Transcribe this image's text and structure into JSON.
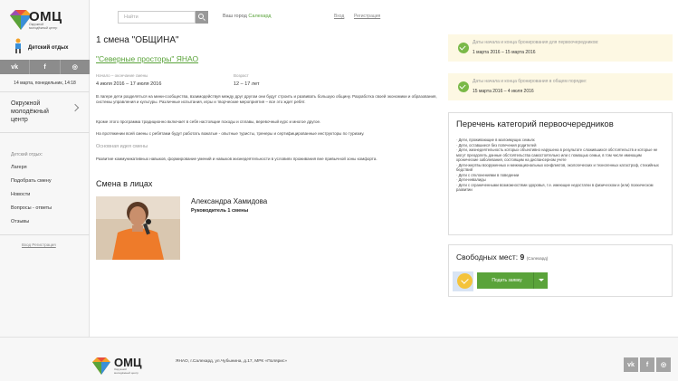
{
  "brand": {
    "name": "ОМЦ",
    "subtitle": "Окружной молодёжный центр",
    "section": "Детский отдых"
  },
  "social": {
    "vk": "vk",
    "fb": "f",
    "ig": "◎"
  },
  "date": "14 марта, понедельник, 14:18",
  "sidebar": {
    "okr": "Окружной молодёжный центр",
    "label": "Детский отдых:",
    "items": [
      "Лагеря",
      "Подобрать смену",
      "Новости",
      "Вопросы - ответы",
      "Отзывы"
    ],
    "login": "Вход Регистрация"
  },
  "search": {
    "placeholder": "Найти"
  },
  "city": {
    "label": "Ваш город",
    "name": "Салехард"
  },
  "auth": {
    "login": "Вход",
    "register": "Регистрация"
  },
  "main": {
    "title": "1 смена \"ОБЩИНА\"",
    "subtitle": "\"Северные просторы\" ЯНАО",
    "period_label": "Начало – окончание смены",
    "period_value": "4 июля 2016 – 17 июля 2016",
    "age_label": "Возраст",
    "age_value": "12 – 17 лет",
    "para1": "В лагере дети разделяться на мини-сообщества, взаимодействуя между друг другом они будут строить и развивать большую общину. Разработка своей экономики и образования, системы управления и культуры. Различные испытания, игры и творческие мероприятия – все это ждет ребят.",
    "para2": "Кроме этого программа традиционно включает в себя настоящие походы и сплавы, веревочный курс и многое другое.",
    "para3": "На протяжении всей смены с ребятами будут работать вожатые - опытные туристы, тренеры и сертифицированные инструкторы по туризму.",
    "idea_label": "Основная идея смены",
    "idea_text": "Развитие коммуникативных навыков, формирование умений и навыков жизнедеятельности в условиях проживания вне привычной зоны комфорта.",
    "faces_title": "Смена в лицах",
    "person_name": "Александра Хамидова",
    "person_role": "Руководитель 1 смены"
  },
  "notices": [
    {
      "label": "Даты начала и конца бронирования для первоочередников:",
      "value": "1 марта 2016 – 15 марта 2016"
    },
    {
      "label": "Даты начала и конца бронирования в общем порядке:",
      "value": "15 марта 2016 – 4 июля 2016"
    }
  ],
  "categories": {
    "title": "Перечень категорий первоочередников",
    "items": [
      "Дети, проживающие в малоимущих семьях",
      "Дети, оставшиеся без попечения родителей",
      "Дети, жизнедеятельность которых объективно нарушена в результате сложившихся обстоятельств и которые не могут преодолеть данные обстоятельства самостоятельно или с помощью семьи, в том числе имеющим хронические заболевания, состоящим на диспансерном учете",
      "Дети-жертвы вооруженных и межнациональных конфликтов, экологических и техногенных катастроф, стихийных бедствий",
      "Дети с отклонениями в поведении",
      "Дети-инвалиды",
      "Дети с ограниченными возможностями здоровья, т.е. имеющие недостатки в физическом и (или) психическом развитии"
    ]
  },
  "booking": {
    "label": "Свободных мест:",
    "count": "9",
    "city": "(Салехард)",
    "button": "Подать заявку"
  },
  "footer": {
    "address": "ЯНАО, г.Салехард, ул.Чубынина, д.17, МРК «Полярис»",
    "logo": "ОМЦ",
    "logo_sub": "Окружной молодёжный центр"
  },
  "colors": {
    "accent": "#5aa33a",
    "notice_bg": "#fdf8e3",
    "check": "#7ab948",
    "star": "#f4c33b"
  }
}
